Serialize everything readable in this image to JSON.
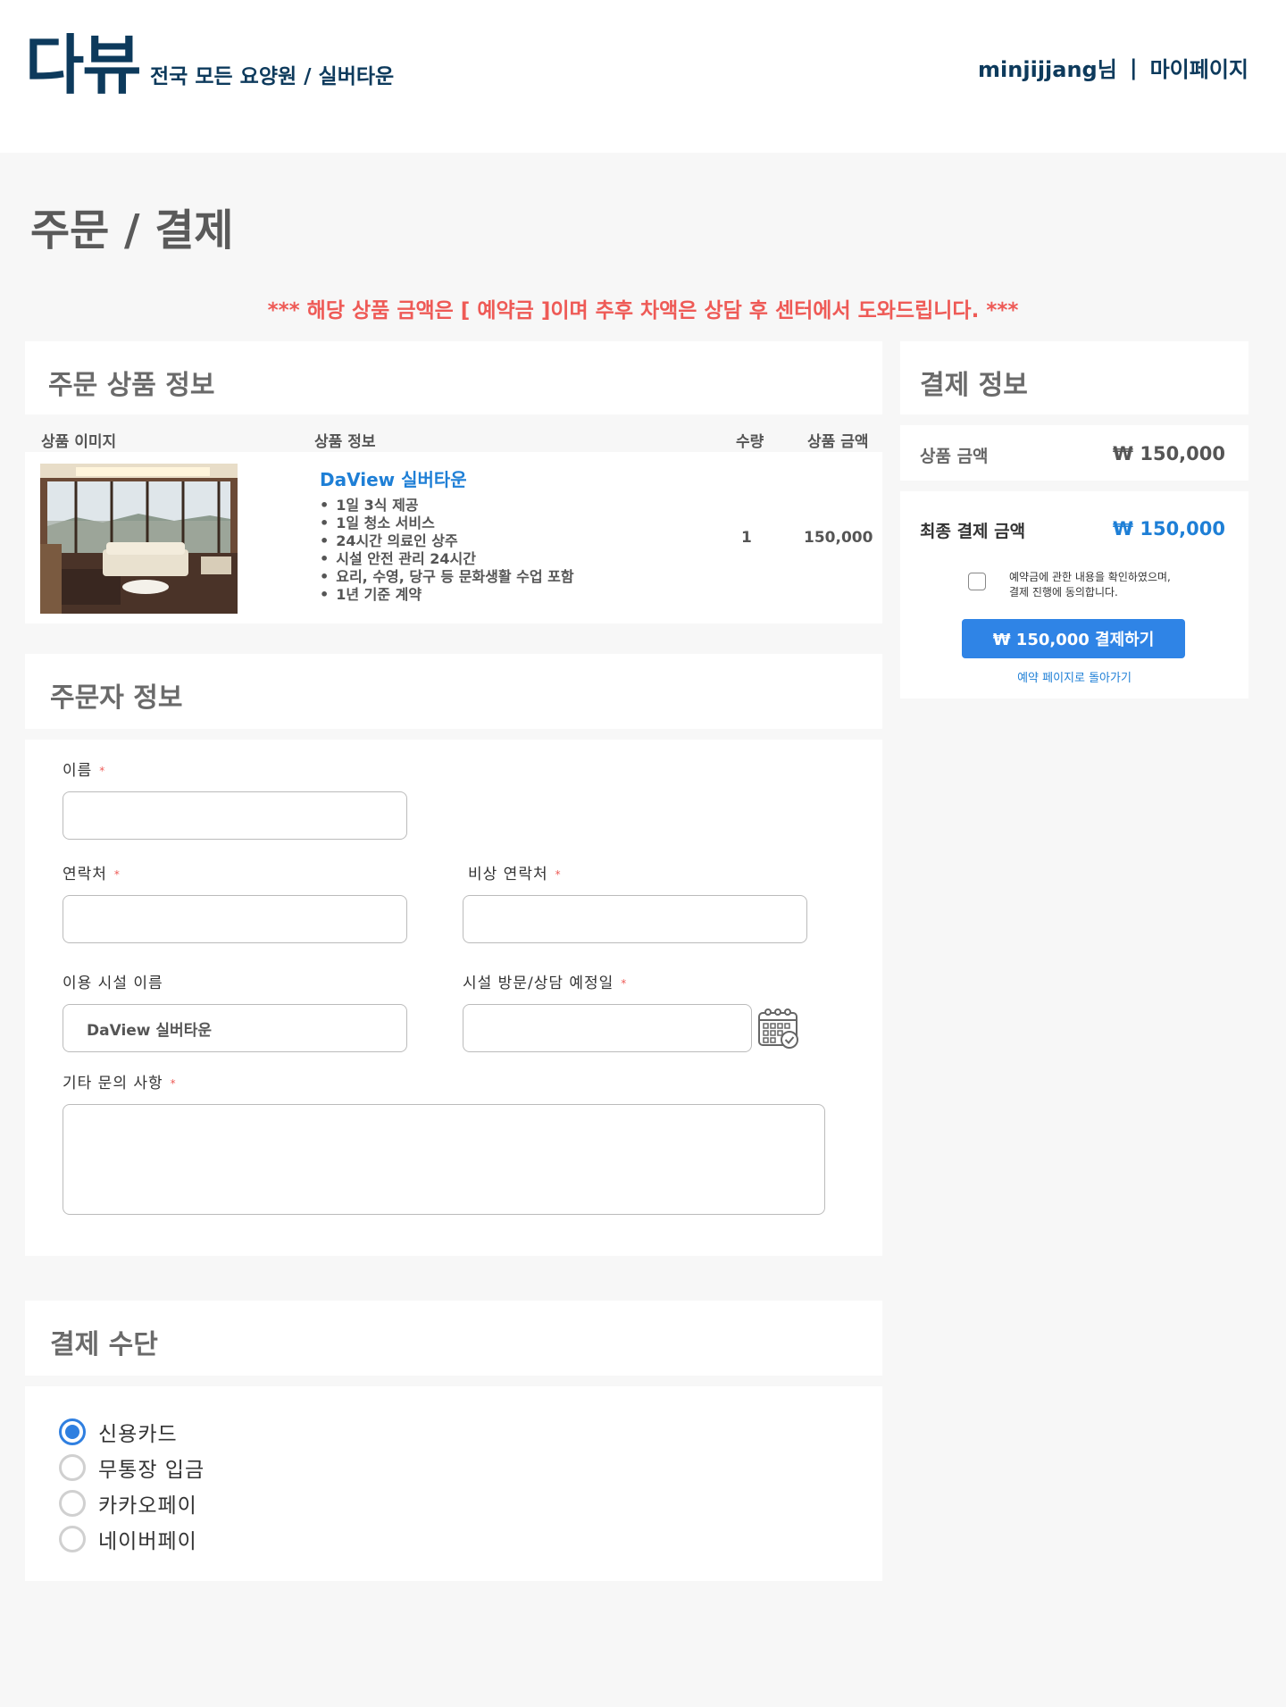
{
  "header": {
    "logo": "다뷰",
    "tagline": "전국 모든 요양원 / 실버타운",
    "username": "minjijjang님",
    "separator": "|",
    "mypage": "마이페이지"
  },
  "page_title": "주문 / 결제",
  "notice": "*** 해당 상품 금액은 [ 예약금 ]이며 추후 차액은 상담 후 센터에서 도와드립니다. ***",
  "order_product": {
    "title": "주문 상품 정보",
    "columns": [
      "상품 이미지",
      "상품 정보",
      "수량",
      "상품 금액"
    ],
    "item": {
      "name": "DaView 실버타운",
      "features": [
        "1일 3식 제공",
        "1일 청소 서비스",
        "24시간 의료인 상주",
        "시설 안전 관리 24시간",
        "요리, 수영, 당구 등 문화생활 수업 포함",
        "1년 기준 계약"
      ],
      "quantity": "1",
      "price": "150,000"
    }
  },
  "orderer": {
    "title": "주문자 정보",
    "required_mark": "*",
    "fields": {
      "name": {
        "label": "이름",
        "value": ""
      },
      "phone": {
        "label": "연락처",
        "value": ""
      },
      "emergency_phone": {
        "label": "비상 연락처",
        "value": ""
      },
      "facility": {
        "label": "이용 시설 이름",
        "value": "DaView 실버타운"
      },
      "visit_date": {
        "label": "시설 방문/상담 예정일",
        "value": ""
      },
      "inquiry": {
        "label": "기타 문의 사항",
        "value": ""
      }
    }
  },
  "payment_method": {
    "title": "결제 수단",
    "options": [
      {
        "label": "신용카드",
        "checked": true
      },
      {
        "label": "무통장 입금",
        "checked": false
      },
      {
        "label": "카카오페이",
        "checked": false
      },
      {
        "label": "네이버페이",
        "checked": false
      }
    ]
  },
  "payment_info": {
    "title": "결제 정보",
    "product_amount_label": "상품 금액",
    "product_amount": "₩ 150,000",
    "final_amount_label": "최종 결제 금액",
    "final_amount": "₩ 150,000",
    "agree_line1": "예약금에 관한 내용을 확인하였으며,",
    "agree_line2": "결제 진행에 동의합니다.",
    "pay_button": "₩ 150,000 결제하기",
    "back_link": "예약 페이지로 돌아가기"
  },
  "colors": {
    "brand": "#0d3a5c",
    "notice": "#ee5a56",
    "accent_blue": "#2f84e6",
    "link_blue": "#1e7fd6"
  },
  "icons": [
    "calendar-icon"
  ]
}
